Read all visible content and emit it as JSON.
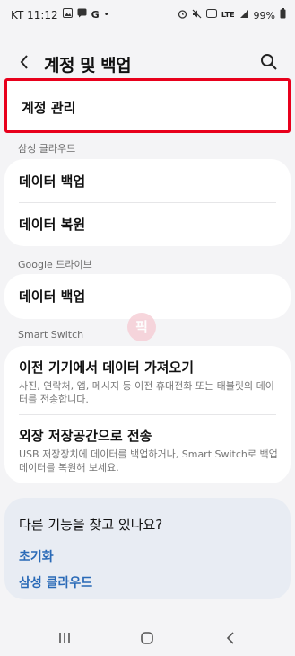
{
  "status": {
    "carrier_time": "KT 11:12",
    "left_icons": [
      "gallery-icon",
      "chat-icon",
      "google-icon",
      "dot-icon"
    ],
    "network_label": "LTE",
    "battery": "99%"
  },
  "header": {
    "title": "계정 및 백업"
  },
  "account": {
    "manage_label": "계정 관리"
  },
  "samsung_cloud": {
    "section_label": "삼성 클라우드",
    "items": [
      "데이터 백업",
      "데이터 복원"
    ]
  },
  "google_drive": {
    "section_label": "Google 드라이브",
    "items": [
      "데이터 백업"
    ]
  },
  "smart_switch": {
    "section_label": "Smart Switch",
    "items": [
      {
        "title": "이전 기기에서 데이터 가져오기",
        "desc": "사진, 연락처, 앱, 메시지 등 이전 휴대전화 또는 태블릿의 데이터를 전송합니다."
      },
      {
        "title": "외장 저장공간으로 전송",
        "desc": "USB 저장장치에 데이터를 백업하거나, Smart Switch로 백업 데이터를 복원해 보세요."
      }
    ]
  },
  "suggestions": {
    "title": "다른 기능을 찾고 있나요?",
    "links": [
      "초기화",
      "삼성 클라우드"
    ]
  },
  "watermark_text": "픽",
  "colors": {
    "highlight_border": "#e8001c",
    "link": "#2a6ab7",
    "background": "#f4f4f6"
  }
}
